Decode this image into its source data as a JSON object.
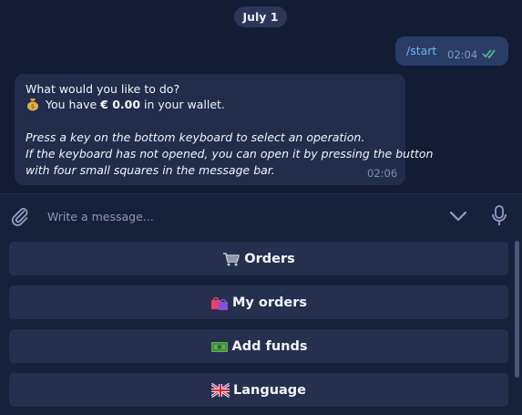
{
  "chat": {
    "date": "July 1",
    "outgoing": {
      "text": "/start",
      "time": "02:04",
      "status_icon": "double-check-icon"
    },
    "incoming": {
      "line1": "What would you like to do?",
      "line2_prefix": "You have ",
      "line2_amount": "€ 0.00",
      "line2_suffix": " in your wallet.",
      "line3": "Press a key on the bottom keyboard to select an operation.",
      "line4": "If the keyboard has not opened, you can open it by pressing the button",
      "line5": "with four small squares in the message bar.",
      "time": "02:06",
      "icon": "money-bag-icon"
    }
  },
  "composer": {
    "placeholder": "Write a message..."
  },
  "keyboard": {
    "buttons": [
      {
        "label": "Orders",
        "icon": "shopping-cart-icon"
      },
      {
        "label": "My orders",
        "icon": "shopping-bags-icon"
      },
      {
        "label": "Add funds",
        "icon": "banknote-icon"
      },
      {
        "label": "Language",
        "icon": "uk-flag-icon"
      }
    ]
  },
  "colors": {
    "chat_bg": "#131c33",
    "bubble_in": "#222d4c",
    "bubble_out": "#2a3d66",
    "link": "#6db8f2",
    "check": "#4fc38a",
    "button_bg": "#25304f"
  }
}
